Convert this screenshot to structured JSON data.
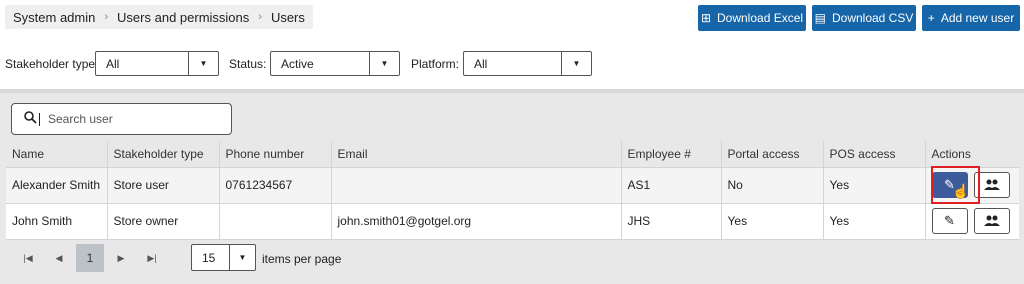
{
  "breadcrumb": [
    "System admin",
    "Users and permissions",
    "Users"
  ],
  "buttons": {
    "download_excel": "Download Excel",
    "download_csv": "Download CSV",
    "add_user": "Add new user"
  },
  "filters": {
    "stakeholder_label": "Stakeholder type:",
    "stakeholder_value": "All",
    "status_label": "Status:",
    "status_value": "Active",
    "platform_label": "Platform:",
    "platform_value": "All"
  },
  "search": {
    "placeholder": "Search user"
  },
  "table": {
    "columns": [
      "Name",
      "Stakeholder type",
      "Phone number",
      "Email",
      "Employee #",
      "Portal access",
      "POS access",
      "Actions"
    ],
    "rows": [
      {
        "name": "Alexander Smith",
        "stakeholder": "Store user",
        "phone": "0761234567",
        "email": "",
        "employee": "AS1",
        "portal": "No",
        "pos": "Yes"
      },
      {
        "name": "John Smith",
        "stakeholder": "Store owner",
        "phone": "",
        "email": "john.smith01@gotgel.org",
        "employee": "JHS",
        "portal": "Yes",
        "pos": "Yes"
      }
    ]
  },
  "pagination": {
    "current_page": "1",
    "items_per_page": "15",
    "items_per_page_label": "items per page"
  },
  "icons": {
    "excel": "grid-icon",
    "csv": "document-icon",
    "add": "plus-icon",
    "edit": "pencil-icon",
    "users": "people-icon",
    "search": "search-icon"
  },
  "colors": {
    "primary": "#1565a8",
    "edit_active": "#3d5a9a",
    "highlight": "#e02020"
  }
}
